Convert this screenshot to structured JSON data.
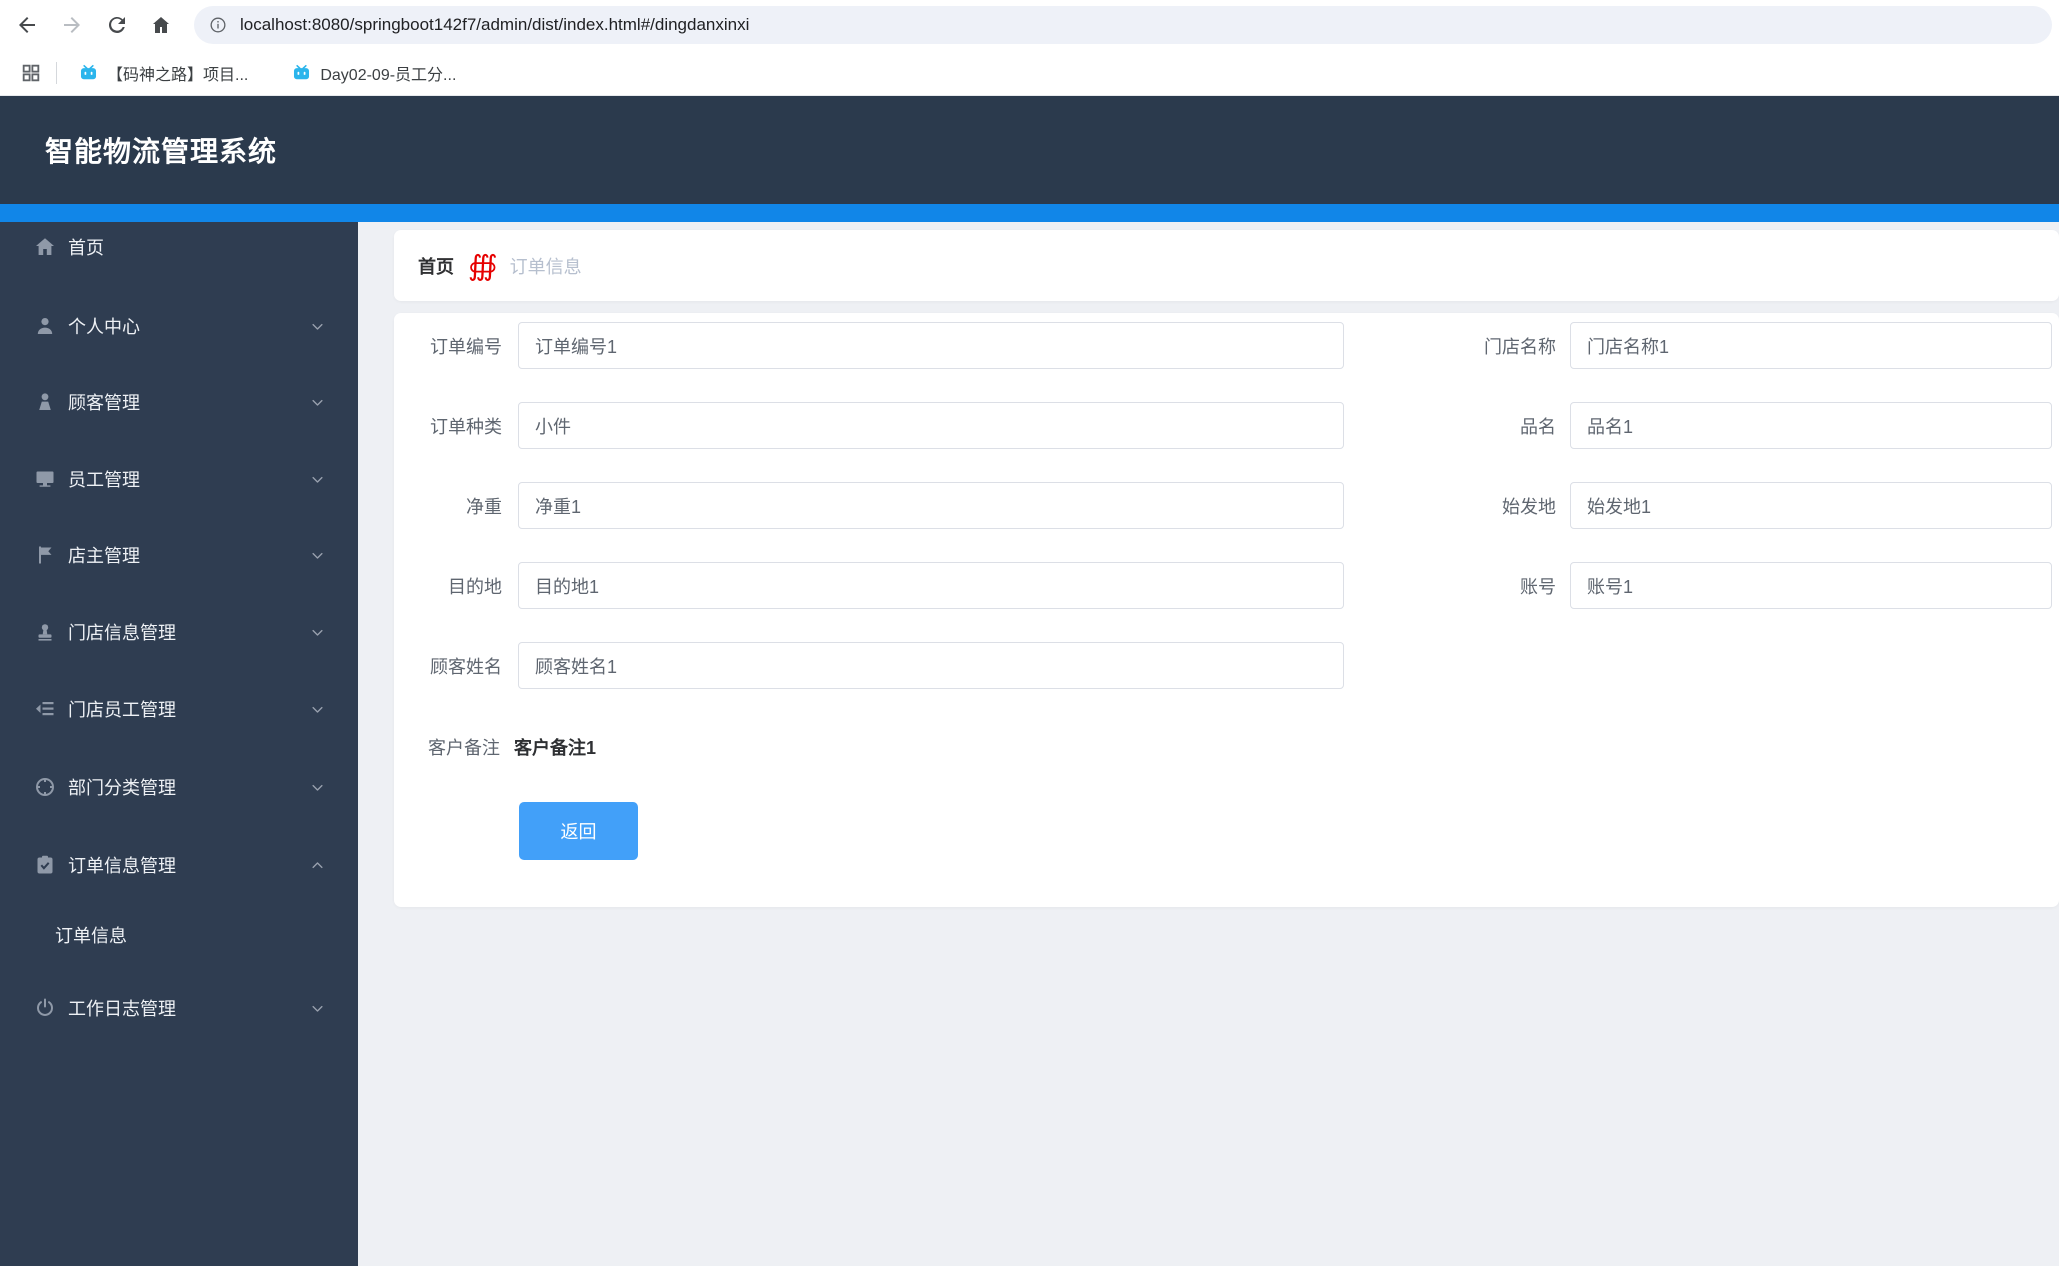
{
  "browser": {
    "url": "localhost:8080/springboot142f7/admin/dist/index.html#/dingdanxinxi",
    "bookmarks": [
      {
        "label": "【码神之路】项目..."
      },
      {
        "label": "Day02-09-员工分..."
      }
    ]
  },
  "header": {
    "title": "智能物流管理系统"
  },
  "sidebar": {
    "items": [
      {
        "label": "首页",
        "icon": "home",
        "chevron": "none",
        "submenu": false
      },
      {
        "label": "个人中心",
        "icon": "user",
        "chevron": "down",
        "submenu": false
      },
      {
        "label": "顾客管理",
        "icon": "customer",
        "chevron": "down",
        "submenu": false
      },
      {
        "label": "员工管理",
        "icon": "monitor",
        "chevron": "down",
        "submenu": false
      },
      {
        "label": "店主管理",
        "icon": "flag",
        "chevron": "down",
        "submenu": false
      },
      {
        "label": "门店信息管理",
        "icon": "stamp",
        "chevron": "down",
        "submenu": false
      },
      {
        "label": "门店员工管理",
        "icon": "indent",
        "chevron": "down",
        "submenu": false
      },
      {
        "label": "部门分类管理",
        "icon": "aim",
        "chevron": "down",
        "submenu": false
      },
      {
        "label": "订单信息管理",
        "icon": "clipboard",
        "chevron": "up",
        "submenu": false
      },
      {
        "label": "订单信息",
        "icon": null,
        "chevron": "none",
        "submenu": true
      },
      {
        "label": "工作日志管理",
        "icon": "power",
        "chevron": "down",
        "submenu": false
      }
    ]
  },
  "breadcrumb": {
    "home": "首页",
    "separator": "∰",
    "current": "订单信息"
  },
  "form": {
    "fields_left": [
      {
        "label": "订单编号",
        "value": "订单编号1"
      },
      {
        "label": "订单种类",
        "value": "小件"
      },
      {
        "label": "净重",
        "value": "净重1"
      },
      {
        "label": "目的地",
        "value": "目的地1"
      },
      {
        "label": "顾客姓名",
        "value": "顾客姓名1"
      }
    ],
    "fields_right": [
      {
        "label": "门店名称",
        "value": "门店名称1"
      },
      {
        "label": "品名",
        "value": "品名1"
      },
      {
        "label": "始发地",
        "value": "始发地1"
      },
      {
        "label": "账号",
        "value": "账号1"
      }
    ],
    "remark": {
      "label": "客户备注",
      "value": "客户备注1"
    },
    "back_button": "返回"
  },
  "colors": {
    "header_bg": "#2b3a4d",
    "sidebar_bg": "#2f3d51",
    "accent_strip": "#1186e8",
    "button_blue": "#42a0f9",
    "breadcrumb_sep_red": "#e60000",
    "bilibili_cyan": "#2bb5ec"
  }
}
